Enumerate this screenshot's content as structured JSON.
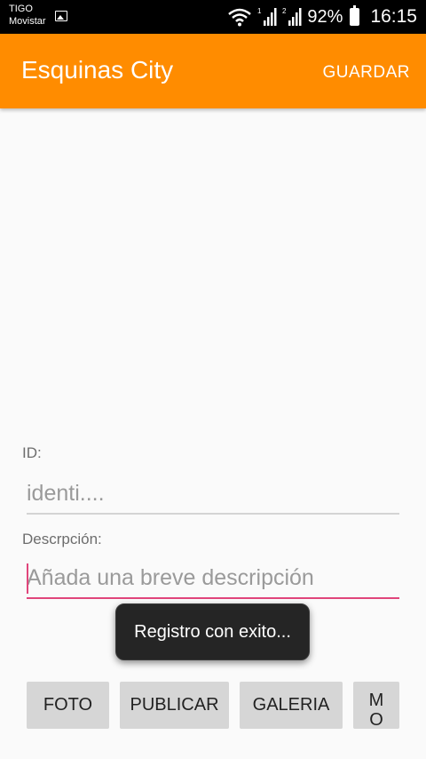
{
  "status_bar": {
    "carrier_1": "TIGO",
    "carrier_2": "Movistar",
    "sim_1_label": "1",
    "sim_2_label": "2",
    "battery_percent": "92%",
    "time": "16:15",
    "icons": [
      "gallery-icon",
      "wifi-icon",
      "signal-sim1-icon",
      "signal-sim2-icon",
      "battery-icon"
    ]
  },
  "app_bar": {
    "title": "Esquinas City",
    "action_label": "GUARDAR",
    "color": "#ff8c00"
  },
  "form": {
    "id_label": "ID:",
    "id_placeholder": "identi....",
    "description_label": "Descrpción:",
    "description_placeholder": "Añada una breve descripción",
    "focus_color": "#e0457b"
  },
  "toast": {
    "message": "Registro con exito..."
  },
  "buttons": {
    "foto": "FOTO",
    "publicar": "PUBLICAR",
    "galeria": "GALERIA",
    "mostrar": "MOS"
  }
}
